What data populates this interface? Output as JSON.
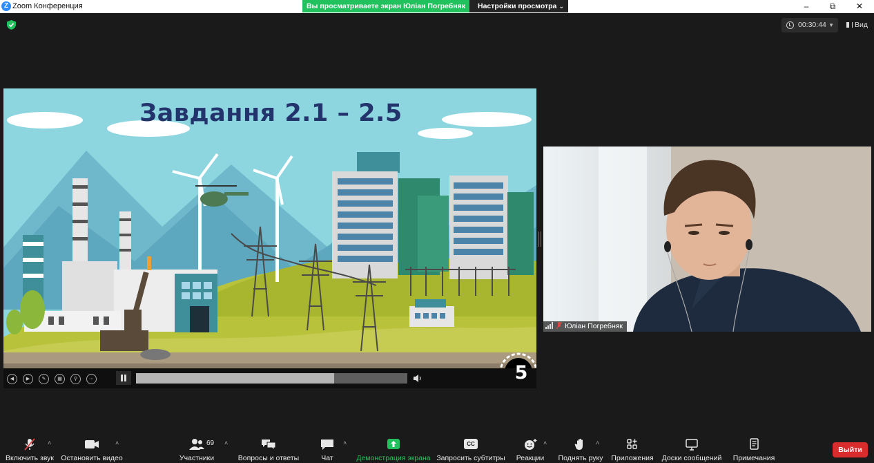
{
  "window": {
    "logo_letter": "Z",
    "title": "Zoom Конференция",
    "share_banner": "Вы просматриваете экран Юліан Погребняк",
    "view_settings": "Настройки просмотра"
  },
  "meeting": {
    "timer": "00:30:44",
    "view_label": "Вид"
  },
  "slide": {
    "title": "Завдання 2.1 – 2.5",
    "counter": "5",
    "progress": 0.73
  },
  "participant": {
    "name": "Юліан Погребняк"
  },
  "toolbar": {
    "mute": "Включить звук",
    "video": "Остановить видео",
    "participants": "Участники",
    "participants_count": "69",
    "qa": "Вопросы и ответы",
    "chat": "Чат",
    "share": "Демонстрация экрана",
    "captions": "Запросить субтитры",
    "cc_text": "CC",
    "reactions": "Реакции",
    "raise_hand": "Поднять руку",
    "apps": "Приложения",
    "whiteboards": "Доски сообщений",
    "notes": "Примечания",
    "leave": "Выйти"
  },
  "colors": {
    "share_green": "#21c15d",
    "leave_red": "#d92c2c",
    "background": "#1a1a1a",
    "slide_title": "#23336b"
  }
}
